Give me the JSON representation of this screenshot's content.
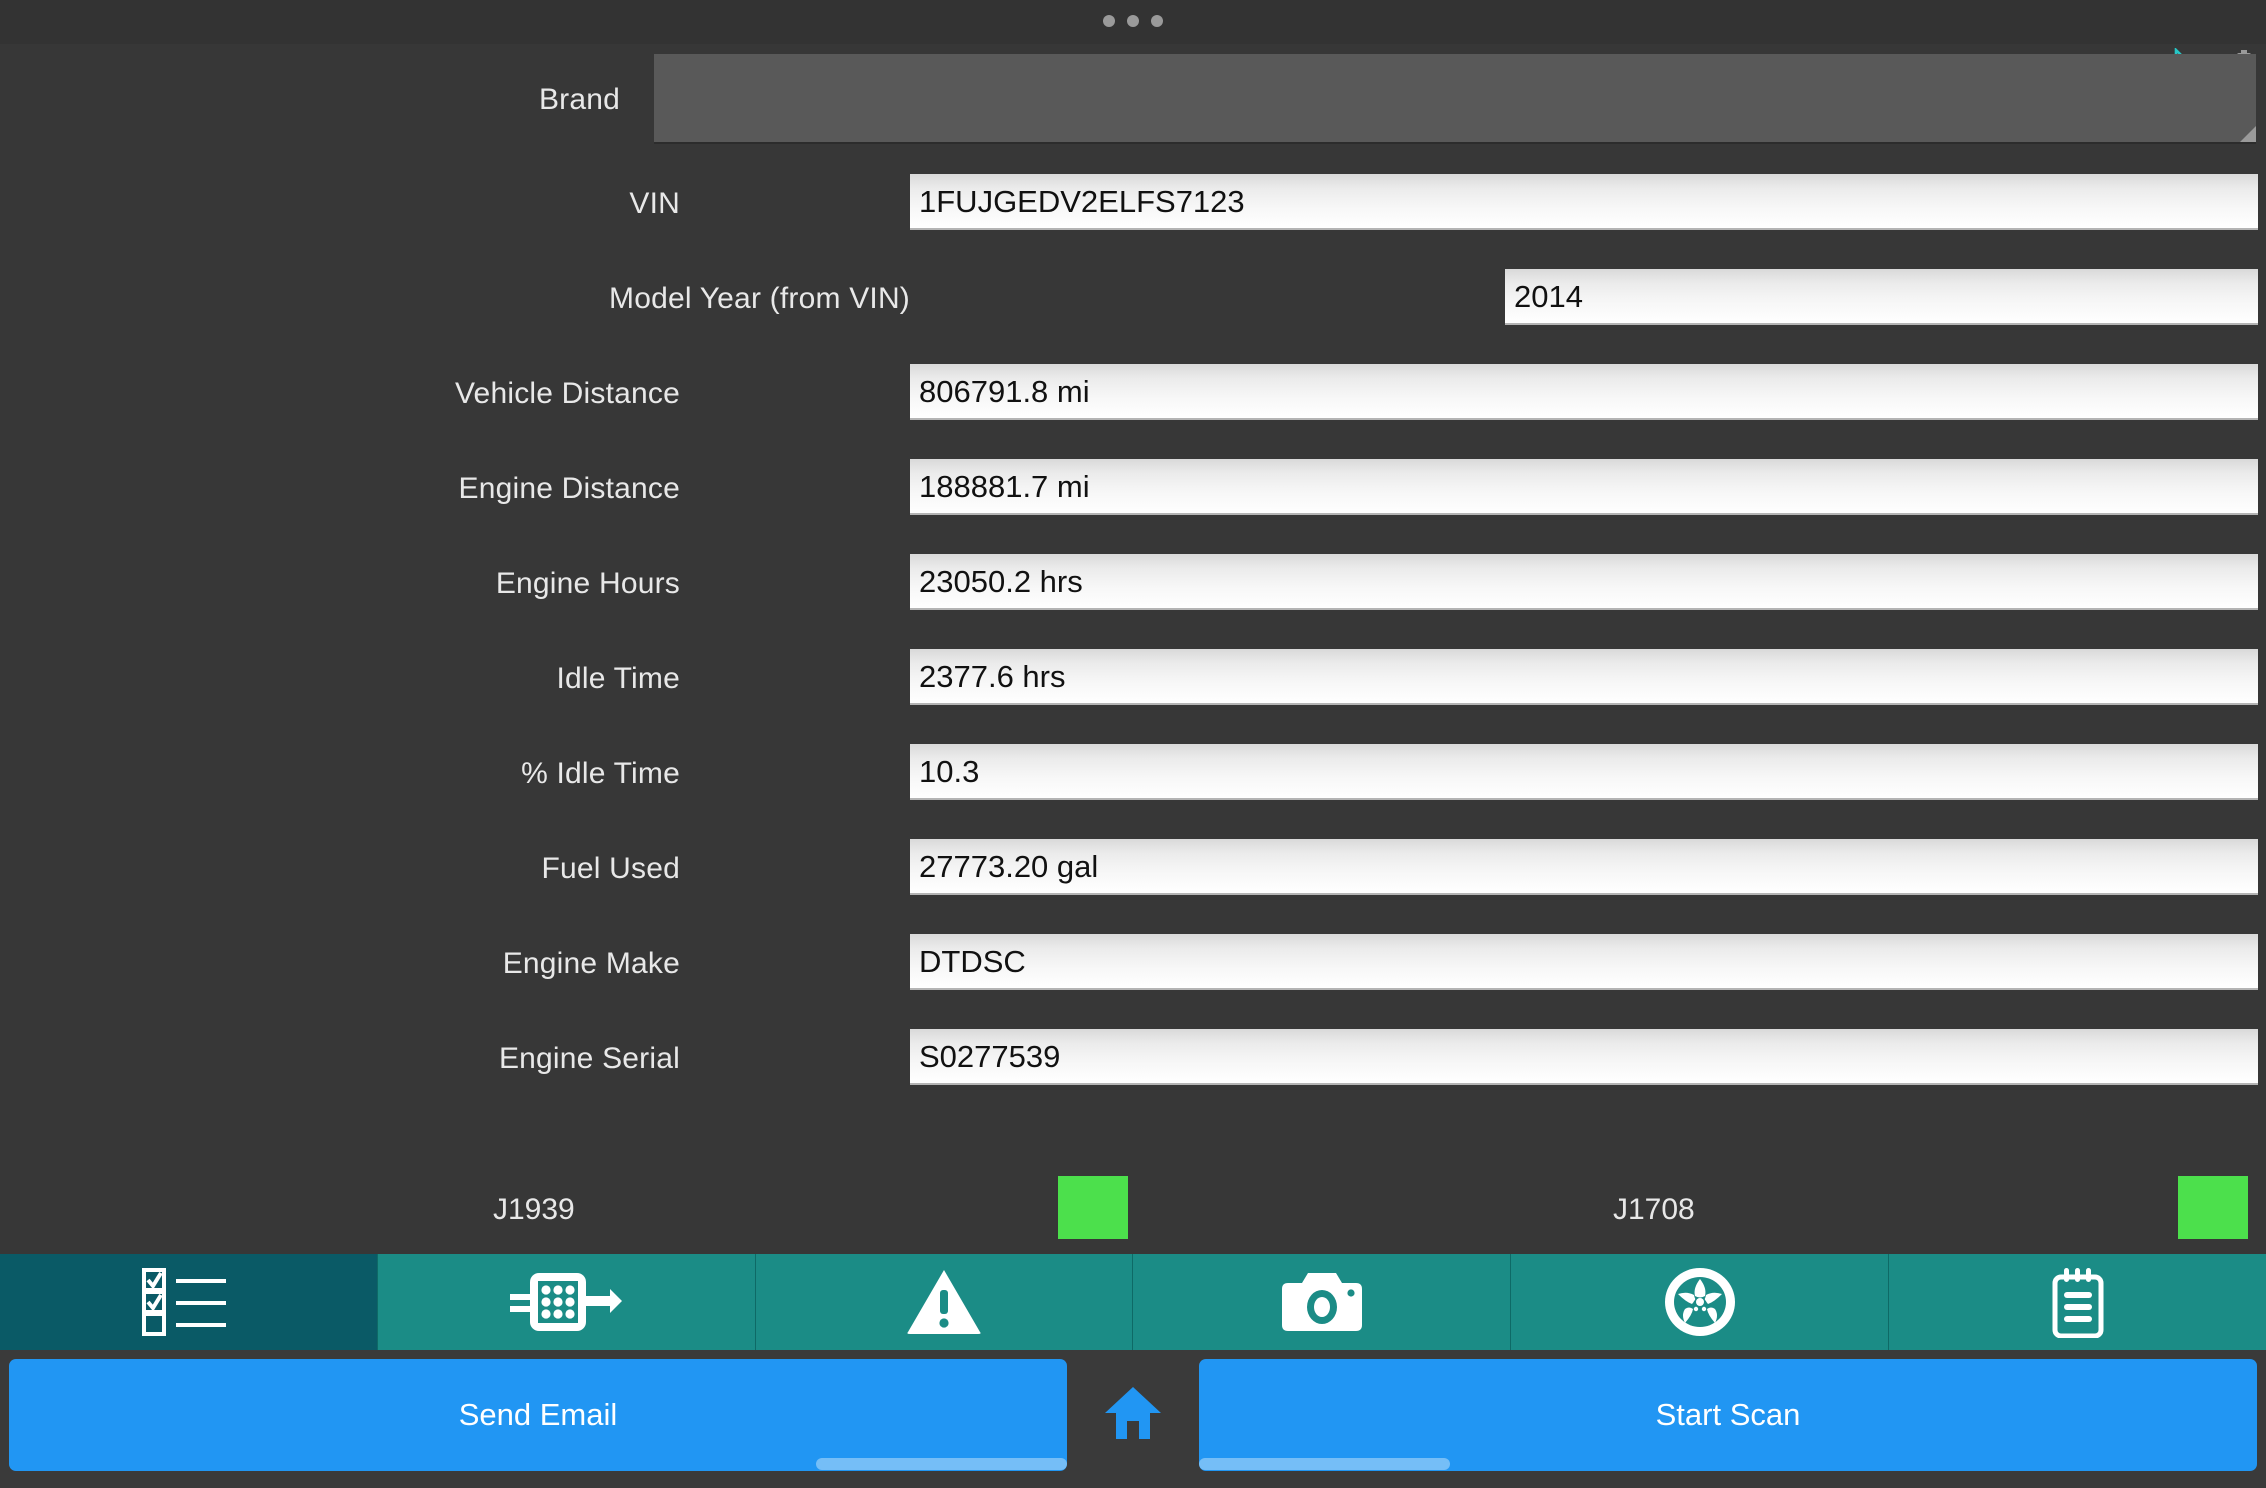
{
  "status_bar": {
    "menu_dots": "•••",
    "icons": [
      {
        "name": "bluetooth-icon",
        "color": "#26c6c6"
      },
      {
        "name": "data-transfer-icon",
        "color": "#9a9a9a"
      },
      {
        "name": "battery-icon",
        "color": "#9a9a9a"
      }
    ]
  },
  "form": {
    "brand": {
      "label": "Brand",
      "value": "",
      "type": "spinner"
    },
    "fields": [
      {
        "label": "VIN",
        "value": "1FUJGEDV2ELFS7123",
        "name": "vin"
      },
      {
        "label": "Model Year (from VIN)",
        "value": "2014",
        "name": "model-year"
      },
      {
        "label": "Vehicle Distance",
        "value": "806791.8 mi",
        "name": "vehicle-distance"
      },
      {
        "label": "Engine Distance",
        "value": "188881.7 mi",
        "name": "engine-distance"
      },
      {
        "label": "Engine Hours",
        "value": "23050.2 hrs",
        "name": "engine-hours"
      },
      {
        "label": "Idle Time",
        "value": "2377.6 hrs",
        "name": "idle-time"
      },
      {
        "label": "% Idle Time",
        "value": "10.3",
        "name": "percent-idle-time"
      },
      {
        "label": "Fuel Used",
        "value": "27773.20 gal",
        "name": "fuel-used"
      },
      {
        "label": "Engine Make",
        "value": "DTDSC",
        "name": "engine-make"
      },
      {
        "label": "Engine Serial",
        "value": "S0277539",
        "name": "engine-serial"
      }
    ]
  },
  "protocols": [
    {
      "label": "J1939",
      "status_color": "#4ce04c"
    },
    {
      "label": "J1708",
      "status_color": "#4ce04c"
    }
  ],
  "tabs": [
    {
      "icon": "checklist-icon",
      "name": "tab-checklist",
      "active": true
    },
    {
      "icon": "connector-icon",
      "name": "tab-connector",
      "active": false
    },
    {
      "icon": "warning-icon",
      "name": "tab-faults",
      "active": false
    },
    {
      "icon": "camera-icon",
      "name": "tab-camera",
      "active": false
    },
    {
      "icon": "wheel-icon",
      "name": "tab-wheel",
      "active": false
    },
    {
      "icon": "notepad-icon",
      "name": "tab-notes",
      "active": false
    }
  ],
  "actions": {
    "send_email_label": "Send Email",
    "start_scan_label": "Start Scan",
    "home_icon": "home-icon",
    "accent_color": "#2196f3"
  }
}
